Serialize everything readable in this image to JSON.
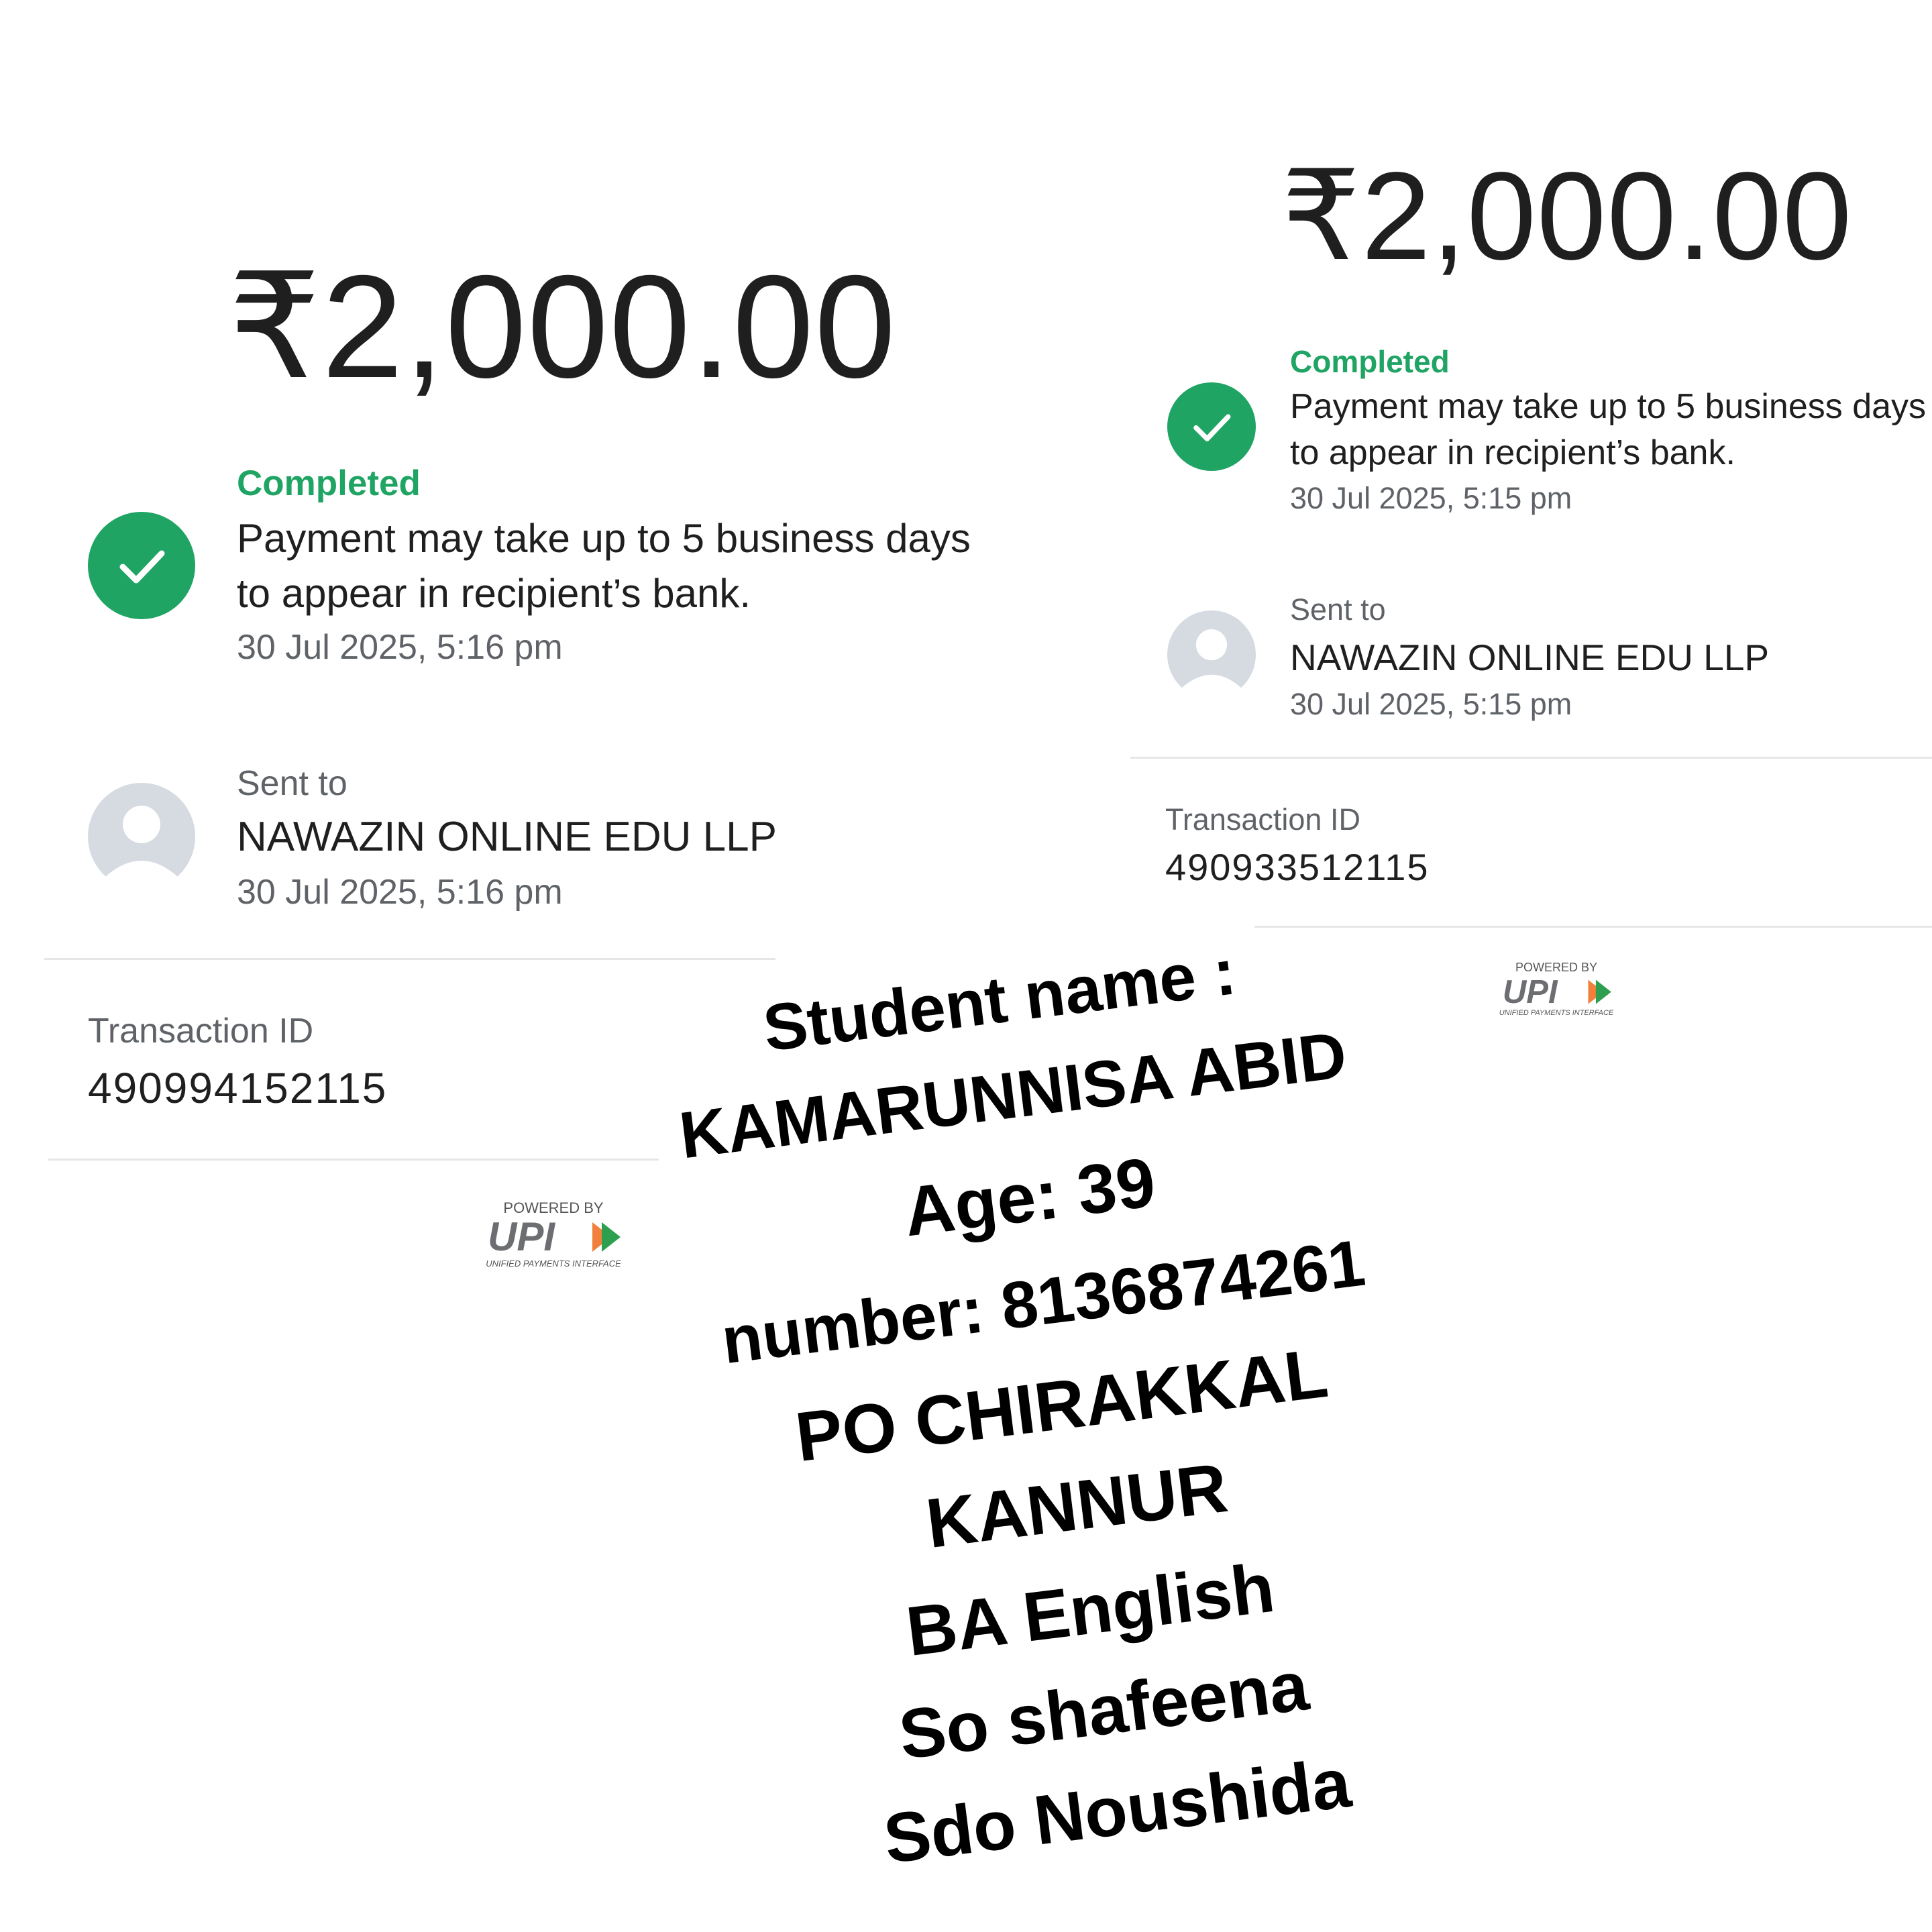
{
  "receipt_left": {
    "amount": "₹2,000.00",
    "status": "Completed",
    "message_line1": "Payment may take up to 5 business days",
    "message_line2": "to appear in recipient’s bank.",
    "status_time": "30 Jul 2025, 5:16 pm",
    "sent_to_label": "Sent to",
    "recipient": "NAWAZIN ONLINE EDU LLP",
    "sent_time": "30 Jul 2025, 5:16 pm",
    "txn_label": "Transaction ID",
    "txn_id": "490994152115",
    "powered_by": "POWERED BY",
    "upi_sub": "UNIFIED PAYMENTS INTERFACE"
  },
  "receipt_right": {
    "amount": "₹2,000.00",
    "status": "Completed",
    "message_line1": "Payment may take up to 5 business days",
    "message_line2": "to appear in recipient’s bank.",
    "status_time": "30 Jul 2025, 5:15 pm",
    "sent_to_label": "Sent to",
    "recipient": "NAWAZIN ONLINE EDU LLP",
    "sent_time": "30 Jul 2025, 5:15 pm",
    "txn_label": "Transaction ID",
    "txn_id": "490933512115",
    "powered_by": "POWERED BY",
    "upi_sub": "UNIFIED PAYMENTS INTERFACE"
  },
  "student_note": {
    "lines": [
      "Student name :",
      "KAMARUNNISA ABID",
      "Age: 39",
      "number: 8136874261",
      "PO CHIRAKKAL",
      "KANNUR",
      "BA English",
      "So shafeena",
      "Sdo Noushida"
    ]
  },
  "colors": {
    "success_green": "#1fa463",
    "avatar_gray": "#d5dbe1",
    "divider": "#e6e6e6",
    "upi_orange": "#f0803c",
    "upi_green": "#2e9e4f"
  },
  "icons": {
    "status": "check-circle-icon",
    "recipient": "person-avatar-icon",
    "brand": "upi-logo"
  }
}
